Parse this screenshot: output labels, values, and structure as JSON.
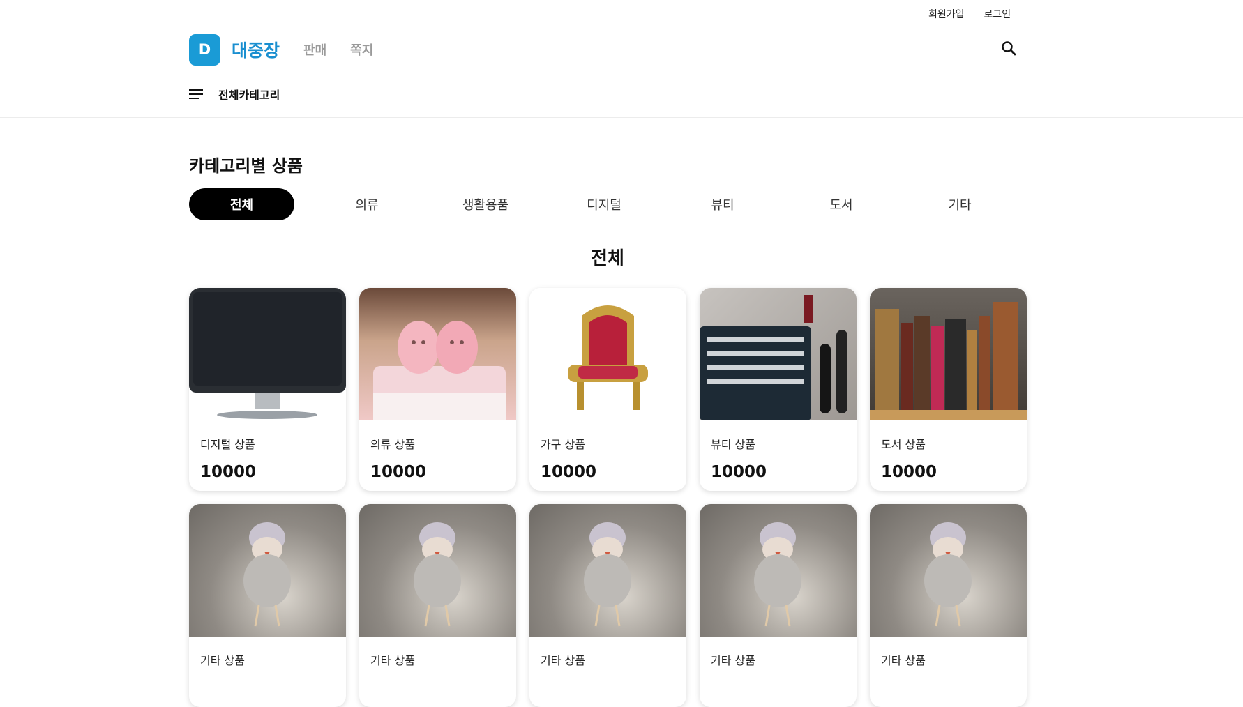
{
  "top_links": {
    "signup": "회원가입",
    "login": "로그인"
  },
  "header": {
    "logo_letter": "D",
    "brand": "대중장",
    "nav": [
      "판매",
      "쪽지"
    ]
  },
  "category_bar": {
    "label": "전체카테고리"
  },
  "section_title": "카테고리별 상품",
  "tabs": [
    "전체",
    "의류",
    "생활용품",
    "디지털",
    "뷰티",
    "도서",
    "기타"
  ],
  "active_tab": "전체",
  "sub_title": "전체",
  "products": [
    {
      "name": "디지털 상품",
      "price": "10000",
      "image": "monitor"
    },
    {
      "name": "의류 상품",
      "price": "10000",
      "image": "baby-shoes"
    },
    {
      "name": "가구 상품",
      "price": "10000",
      "image": "chair"
    },
    {
      "name": "뷰티 상품",
      "price": "10000",
      "image": "makeup-brushes"
    },
    {
      "name": "도서 상품",
      "price": "10000",
      "image": "books"
    },
    {
      "name": "기타 상품",
      "price": "",
      "image": "bird-figure"
    },
    {
      "name": "기타 상품",
      "price": "",
      "image": "bird-figure"
    },
    {
      "name": "기타 상품",
      "price": "",
      "image": "bird-figure"
    },
    {
      "name": "기타 상품",
      "price": "",
      "image": "bird-figure"
    },
    {
      "name": "기타 상품",
      "price": "",
      "image": "bird-figure"
    }
  ],
  "colors": {
    "brand": "#1a8fd0",
    "logo_bg": "#1a9bd6",
    "active_tab_bg": "#000000"
  }
}
